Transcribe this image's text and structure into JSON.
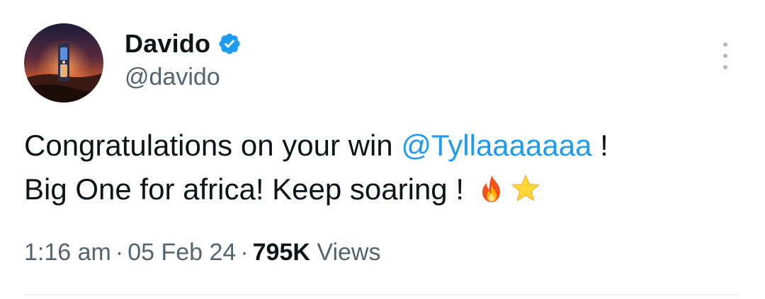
{
  "author": {
    "display_name": "Davido",
    "handle": "@davido",
    "verified": true
  },
  "tweet": {
    "line1_prefix": "Congratulations on your win ",
    "mention": "@Tyllaaaaaaa",
    "line1_suffix": " !",
    "line2": "Big One for africa! Keep soaring ! ",
    "emojis": [
      "fire-emoji",
      "star-emoji"
    ]
  },
  "meta": {
    "time": "1:16 am",
    "separator": "·",
    "date": "05 Feb 24",
    "views_count": "795K",
    "views_label": "Views"
  },
  "colors": {
    "link": "#1d9bf0",
    "secondary_text": "#536471",
    "verified_badge": "#1d9bf0"
  },
  "icons": {
    "verified": "verified-badge-icon",
    "more": "more-options-icon"
  }
}
